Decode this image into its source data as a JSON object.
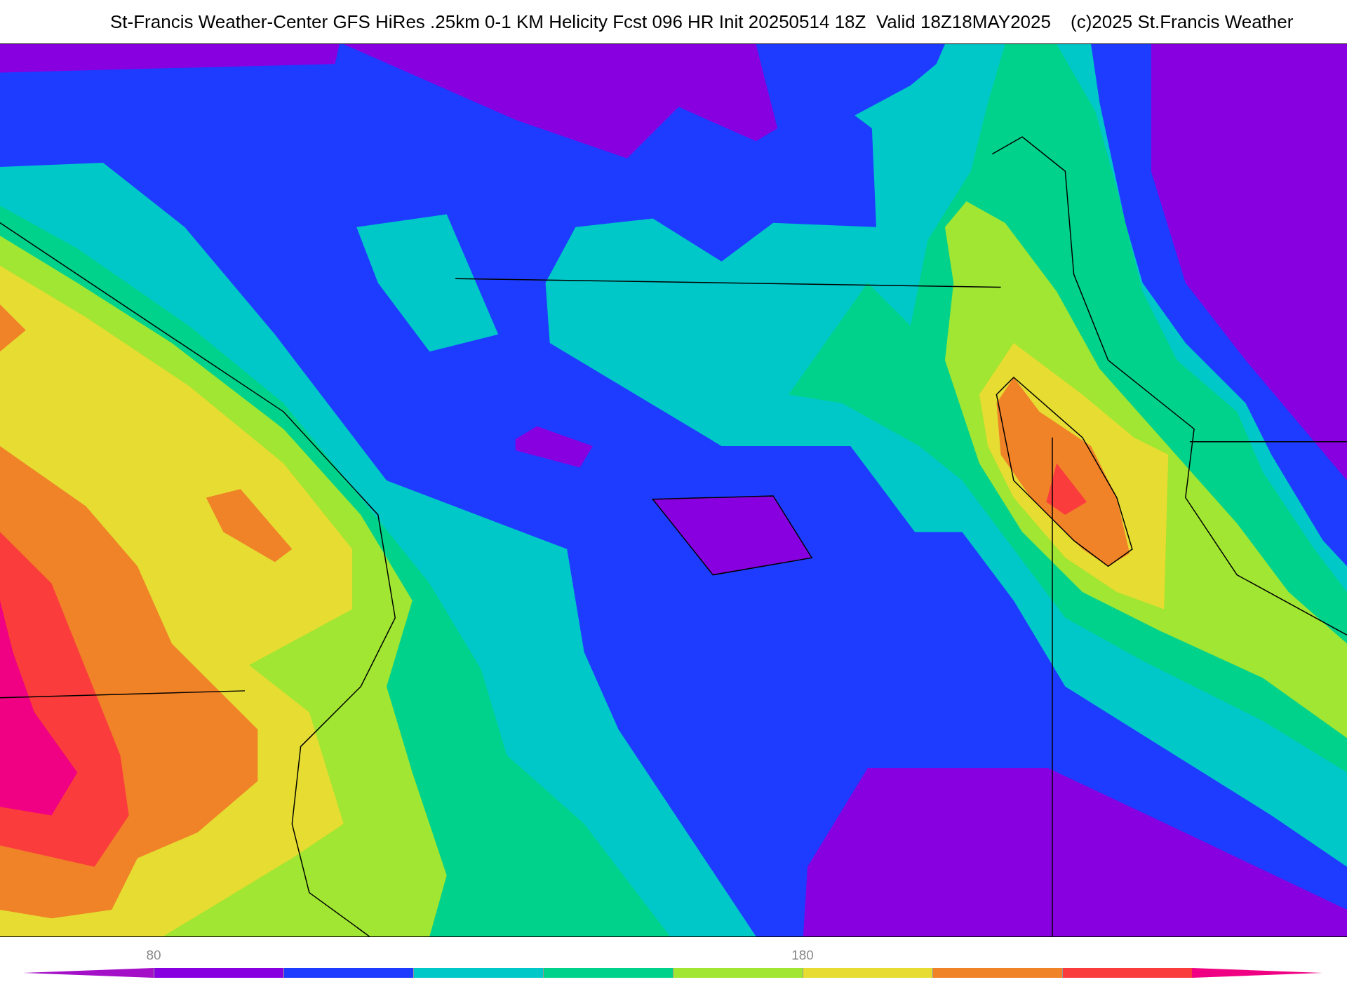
{
  "header": {
    "title": "St-Francis Weather-Center GFS HiRes .25km 0-1 KM Helicity Fcst 096 HR Init 20250514 18Z  Valid 18Z18MAY2025",
    "copyright": "(c)2025 St.Francis Weather"
  },
  "legend": {
    "segments": [
      {
        "kind": "triangle-left",
        "color": "#a40fc8"
      },
      {
        "kind": "rect",
        "color": "#8800e0",
        "tick_label": "80"
      },
      {
        "kind": "rect",
        "color": "#1e3cff"
      },
      {
        "kind": "rect",
        "color": "#00c8c8"
      },
      {
        "kind": "rect",
        "color": "#00d28c"
      },
      {
        "kind": "rect",
        "color": "#a0e632"
      },
      {
        "kind": "rect",
        "color": "#e6dc32",
        "tick_label": "180"
      },
      {
        "kind": "rect",
        "color": "#f08228"
      },
      {
        "kind": "rect",
        "color": "#fa3c3c"
      },
      {
        "kind": "triangle-right",
        "color": "#f00082"
      }
    ]
  }
}
